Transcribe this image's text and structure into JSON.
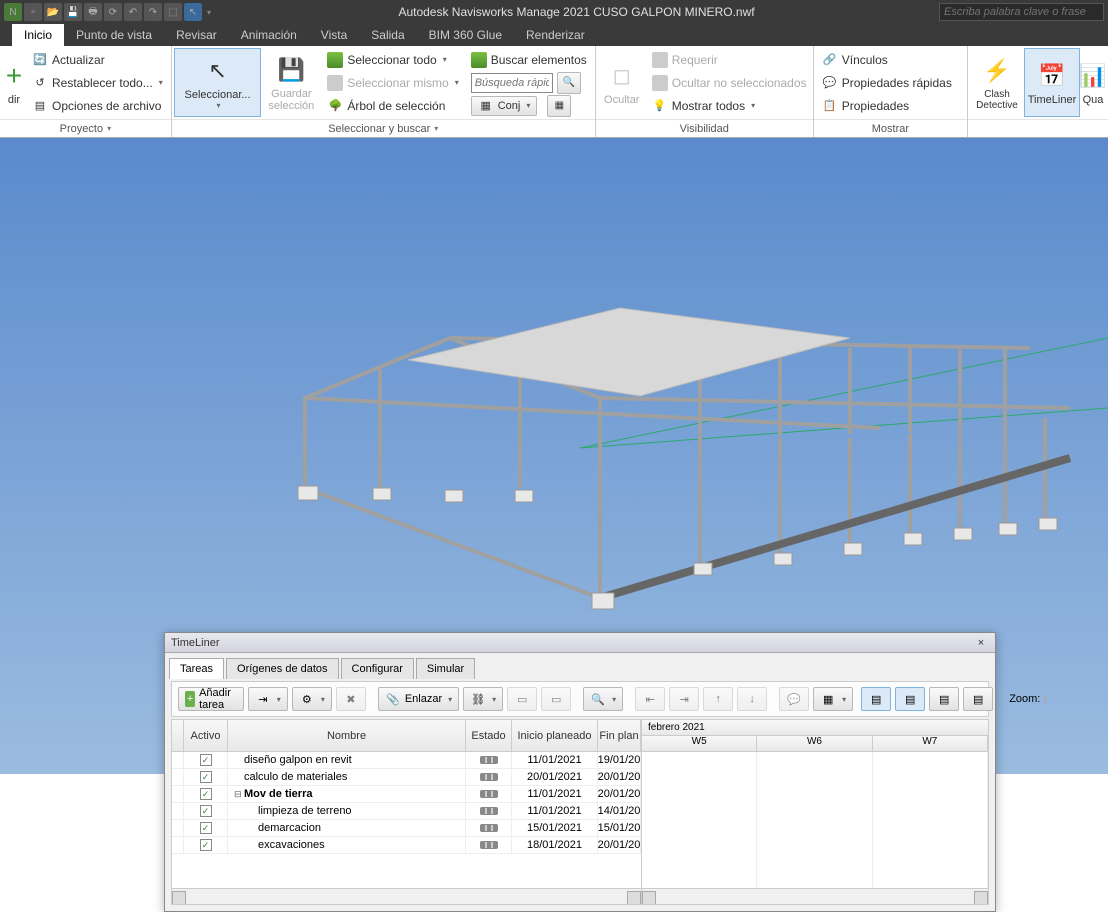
{
  "app": {
    "title": "Autodesk Navisworks Manage 2021   CUSO GALPON MINERO.nwf",
    "search_placeholder": "Escriba palabra clave o frase"
  },
  "ribbon": {
    "tabs": [
      "Inicio",
      "Punto de vista",
      "Revisar",
      "Animación",
      "Vista",
      "Salida",
      "BIM 360 Glue",
      "Renderizar"
    ],
    "active_tab": "Inicio",
    "groups": {
      "proyecto": {
        "label": "Proyecto",
        "items": {
          "anadir": "dir",
          "actualizar": "Actualizar",
          "restablecer": "Restablecer todo...",
          "opciones": "Opciones de archivo"
        }
      },
      "seleccionar": {
        "btn": "Seleccionar...",
        "guardar": "Guardar selección",
        "todo": "Seleccionar todo",
        "mismo": "Seleccionar mismo",
        "arbol": "Árbol de selección",
        "buscar": "Buscar elementos",
        "busqueda_ph": "Búsqueda rápid",
        "conj": "Conj",
        "label": "Seleccionar y buscar"
      },
      "visibilidad": {
        "ocultar": "Ocultar",
        "requerir": "Requerir",
        "ocultar_no": "Ocultar no seleccionados",
        "mostrar": "Mostrar todos",
        "label": "Visibilidad"
      },
      "mostrar": {
        "vinculos": "Vínculos",
        "prop_rap": "Propiedades rápidas",
        "prop": "Propiedades",
        "label": "Mostrar"
      },
      "herramientas": {
        "clash": "Clash Detective",
        "timeliner": "TimeLiner",
        "qua": "Qua"
      }
    }
  },
  "timeliner": {
    "title": "TimeLiner",
    "tabs": [
      "Tareas",
      "Orígenes de datos",
      "Configurar",
      "Simular"
    ],
    "active_tab": "Tareas",
    "toolbar": {
      "anadir": "Añadir tarea",
      "enlazar": "Enlazar",
      "zoom": "Zoom:"
    },
    "columns": [
      "Activo",
      "Nombre",
      "Estado",
      "Inicio planeado",
      "Fin plan"
    ],
    "month_header": "febrero 2021",
    "weeks": [
      "W5",
      "W6",
      "W7"
    ],
    "rows": [
      {
        "activo": true,
        "nombre": "diseño galpon en revit",
        "inicio": "11/01/2021",
        "fin": "19/01/20",
        "bold": false,
        "indent": 0
      },
      {
        "activo": true,
        "nombre": "calculo de materiales",
        "inicio": "20/01/2021",
        "fin": "20/01/20",
        "bold": false,
        "indent": 0
      },
      {
        "activo": true,
        "nombre": "Mov de tierra",
        "inicio": "11/01/2021",
        "fin": "20/01/20",
        "bold": true,
        "indent": 0,
        "expand": true
      },
      {
        "activo": true,
        "nombre": "limpieza de terreno",
        "inicio": "11/01/2021",
        "fin": "14/01/20",
        "bold": false,
        "indent": 1
      },
      {
        "activo": true,
        "nombre": "demarcacion",
        "inicio": "15/01/2021",
        "fin": "15/01/20",
        "bold": false,
        "indent": 1
      },
      {
        "activo": true,
        "nombre": "excavaciones",
        "inicio": "18/01/2021",
        "fin": "20/01/20",
        "bold": false,
        "indent": 1
      }
    ]
  }
}
